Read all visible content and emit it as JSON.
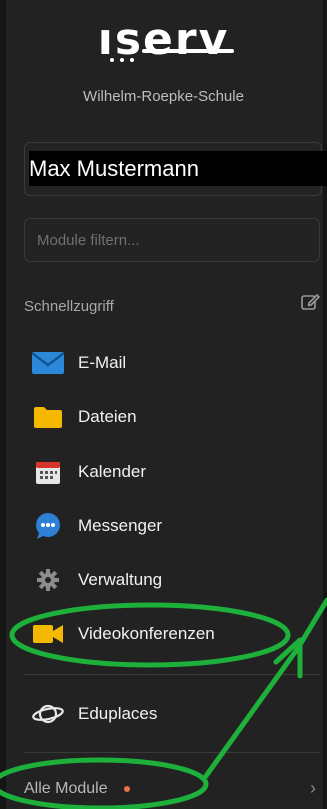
{
  "brand": {
    "logo_text": "ıserv",
    "school": "Wilhelm-Roepke-Schule"
  },
  "user": {
    "name": "Max Mustermann"
  },
  "filter": {
    "placeholder": "Module filtern..."
  },
  "quick_access": {
    "title": "Schnellzugriff",
    "edit_icon": "pencil-edit-icon",
    "items": [
      {
        "label": "E-Mail",
        "icon": "mail-icon"
      },
      {
        "label": "Dateien",
        "icon": "folder-icon"
      },
      {
        "label": "Kalender",
        "icon": "calendar-icon"
      },
      {
        "label": "Messenger",
        "icon": "chat-icon"
      },
      {
        "label": "Verwaltung",
        "icon": "gear-icon"
      },
      {
        "label": "Videokonferenzen",
        "icon": "video-camera-icon"
      }
    ]
  },
  "extras": {
    "eduplaces_label": "Eduplaces"
  },
  "footer": {
    "all_modules_label": "Alle Module",
    "chevron": "›"
  },
  "colors": {
    "background": "#222222",
    "accent_orange": "#e8734a",
    "annotation_green": "#1db03a",
    "mail_blue": "#2b88d8",
    "folder_yellow": "#f5b800",
    "video_yellow": "#f5b800"
  }
}
